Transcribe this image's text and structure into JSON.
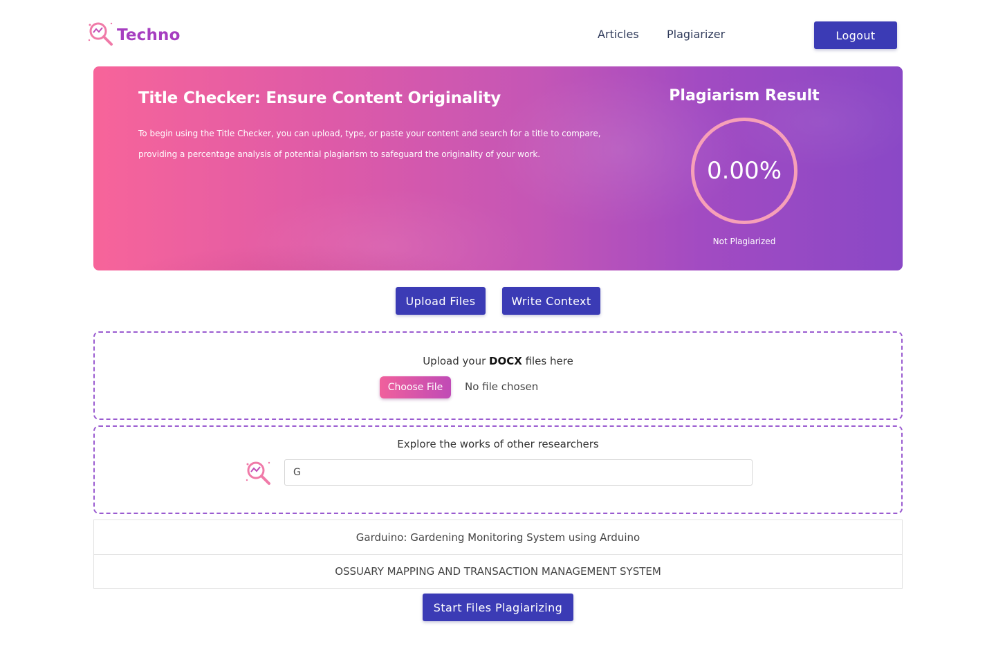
{
  "nav": {
    "brand": "Techno",
    "brand_icon": "magnifier-logo-icon",
    "links": [
      "Articles",
      "Plagiarizer"
    ],
    "logout_label": "Logout"
  },
  "hero": {
    "title": "Title Checker: Ensure Content Originality",
    "description": "To begin using the Title Checker, you can upload, type, or paste your content and search for a title to compare, providing a percentage analysis of potential plagiarism to safeguard the originality of your work.",
    "result_title": "Plagiarism Result",
    "result_value": "0.00%",
    "result_status": "Not Plagiarized"
  },
  "tabs": {
    "upload_label": "Upload Files",
    "write_label": "Write Context"
  },
  "upload": {
    "label_prefix": "Upload your ",
    "label_bold": "DOCX",
    "label_suffix": " files here",
    "choose_label": "Choose File",
    "no_file_text": "No file chosen"
  },
  "search": {
    "label": "Explore the works of other researchers",
    "value": "G",
    "icon": "magnifier-logo-icon"
  },
  "results": [
    "Garduino: Gardening Monitoring System using Arduino",
    "OSSUARY MAPPING AND TRANSACTION MANAGEMENT SYSTEM"
  ],
  "start_label": "Start Files Plagiarizing",
  "colors": {
    "primary": "#3b3bb5",
    "gradient_start": "#f7649a",
    "gradient_end": "#8a48c6",
    "dashed_border": "#9a5bd0",
    "brand": "#a63ec0"
  }
}
